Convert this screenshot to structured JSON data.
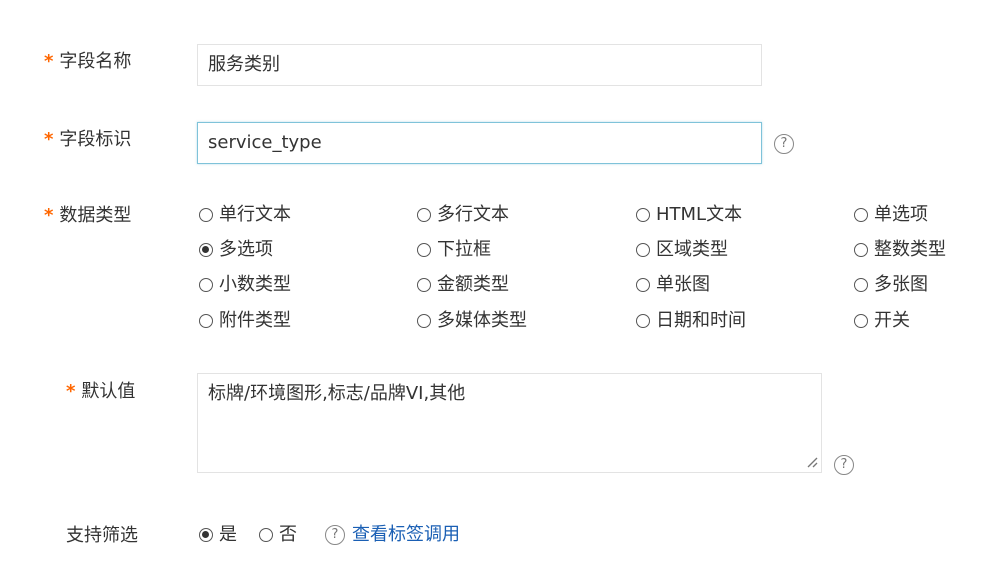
{
  "form": {
    "field_name": {
      "label": "字段名称",
      "required": "*",
      "value": "服务类别"
    },
    "field_id": {
      "label": "字段标识",
      "required": "*",
      "value": "service_type",
      "help": "?"
    },
    "data_type": {
      "label": "数据类型",
      "required": "*",
      "selected": "多选项",
      "options": [
        "单行文本",
        "多行文本",
        "HTML文本",
        "单选项",
        "多选项",
        "下拉框",
        "区域类型",
        "整数类型",
        "小数类型",
        "金额类型",
        "单张图",
        "多张图",
        "附件类型",
        "多媒体类型",
        "日期和时间",
        "开关"
      ]
    },
    "default_value": {
      "label": "默认值",
      "required": "*",
      "value": "标牌/环境图形,标志/品牌VI,其他",
      "help": "?"
    },
    "filter": {
      "label": "支持筛选",
      "yes": "是",
      "no": "否",
      "selected": "是",
      "help": "?",
      "link_text": "查看标签调用"
    }
  }
}
